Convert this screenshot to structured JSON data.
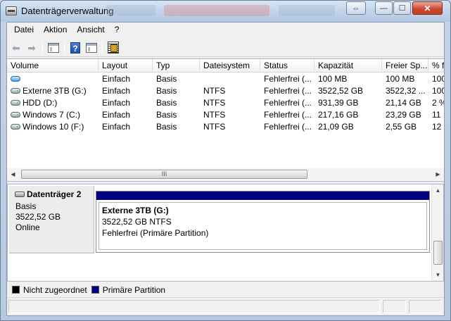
{
  "window": {
    "title": "Datenträgerverwaltung",
    "controls": {
      "restore": "⇔",
      "minimize": "—",
      "maximize": "☐",
      "close": "✕"
    }
  },
  "menubar": {
    "items": [
      "Datei",
      "Aktion",
      "Ansicht",
      "?"
    ]
  },
  "toolbar": {
    "icons": [
      "back-icon",
      "forward-icon",
      "console-tree-icon",
      "help-icon",
      "show-hide-panel-icon",
      "properties-icon"
    ]
  },
  "volume_list": {
    "columns": [
      "Volume",
      "Layout",
      "Typ",
      "Dateisystem",
      "Status",
      "Kapazität",
      "Freier Sp...",
      "% f"
    ],
    "rows": [
      {
        "volume": "",
        "layout": "Einfach",
        "typ": "Basis",
        "dateisystem": "",
        "status": "Fehlerfrei (...",
        "kapazitaet": "100 MB",
        "frei": "100 MB",
        "prozent": "100",
        "icon": "blue-volume-icon"
      },
      {
        "volume": "Externe 3TB (G:)",
        "layout": "Einfach",
        "typ": "Basis",
        "dateisystem": "NTFS",
        "status": "Fehlerfrei (...",
        "kapazitaet": "3522,52 GB",
        "frei": "3522,32 ...",
        "prozent": "100",
        "icon": "drive-icon"
      },
      {
        "volume": "HDD (D:)",
        "layout": "Einfach",
        "typ": "Basis",
        "dateisystem": "NTFS",
        "status": "Fehlerfrei (...",
        "kapazitaet": "931,39 GB",
        "frei": "21,14 GB",
        "prozent": "2 %",
        "icon": "drive-icon"
      },
      {
        "volume": "Windows 7 (C:)",
        "layout": "Einfach",
        "typ": "Basis",
        "dateisystem": "NTFS",
        "status": "Fehlerfrei (...",
        "kapazitaet": "217,16 GB",
        "frei": "23,29 GB",
        "prozent": "11",
        "icon": "drive-icon"
      },
      {
        "volume": "Windows 10 (F:)",
        "layout": "Einfach",
        "typ": "Basis",
        "dateisystem": "NTFS",
        "status": "Fehlerfrei (...",
        "kapazitaet": "21,09 GB",
        "frei": "2,55 GB",
        "prozent": "12",
        "icon": "drive-icon"
      }
    ],
    "scroll_grip": "III"
  },
  "disk": {
    "name": "Datenträger 2",
    "type": "Basis",
    "size": "3522,52 GB",
    "state": "Online",
    "partition": {
      "name": "Externe 3TB  (G:)",
      "size_fs": "3522,52 GB NTFS",
      "status": "Fehlerfrei (Primäre Partition)"
    }
  },
  "legend": [
    {
      "label": "Nicht zugeordnet",
      "color": "#000000"
    },
    {
      "label": "Primäre Partition",
      "color": "#000080"
    }
  ]
}
